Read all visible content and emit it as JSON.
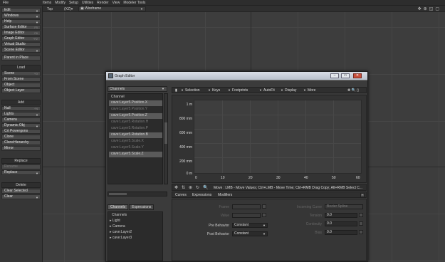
{
  "topbar": {
    "file_label": "File",
    "menu": [
      "Items",
      "Modify",
      "Setup",
      "Utilities",
      "Render",
      "View",
      "Modeler Tools"
    ]
  },
  "sidebar": {
    "buttons": [
      {
        "label": "Edit",
        "arrow": true
      },
      {
        "label": "Windows",
        "arrow": true
      },
      {
        "label": "Help",
        "arrow": true
      },
      {
        "label": "Surface Editor",
        "key": "F5"
      },
      {
        "label": "Image Editor",
        "key": "F6"
      },
      {
        "label": "Graph Editor",
        "key": "^F2"
      },
      {
        "label": "Virtual Studio"
      },
      {
        "label": "Scene Editor",
        "arrow": true
      },
      {
        "label": "Parent in Place"
      }
    ],
    "load_head": "Load",
    "load_buttons": [
      {
        "label": "Scene",
        "key": "^O"
      },
      {
        "label": "From Scene"
      },
      {
        "label": "Object"
      },
      {
        "label": "Object Layer"
      }
    ],
    "add_head": "Add",
    "add_buttons": [
      {
        "label": "Null",
        "key": "^N"
      },
      {
        "label": "Lights",
        "arrow": true
      },
      {
        "label": "Camera"
      },
      {
        "label": "Dynamic Obj",
        "arrow": true
      },
      {
        "label": "Crt Powergons"
      },
      {
        "label": "Clone"
      },
      {
        "label": "CloneHierarchy"
      },
      {
        "label": "Mirror"
      }
    ],
    "replace_head": "Replace",
    "replace_buttons": [
      {
        "label": "Rename",
        "dim": true
      },
      {
        "label": "Replace",
        "arrow": true
      }
    ],
    "delete_head": "Delete",
    "delete_buttons": [
      {
        "label": "Clear Selected"
      },
      {
        "label": "Clear",
        "arrow": true
      }
    ]
  },
  "viewport": {
    "view": "Top",
    "mode": "(XZ)▾",
    "shading": "▣ Wireframe",
    "icons": [
      "✥",
      "⊕",
      "◱",
      "▢"
    ]
  },
  "graph_editor": {
    "title": "Graph Editor",
    "win_buttons": [
      "–",
      "▭",
      "✕"
    ],
    "channels_dropdown": "Channels",
    "channel_header": "Channel",
    "channels": [
      {
        "label": "cave:Layer5.Position.X",
        "state": "sel"
      },
      {
        "label": "cave:Layer5.Position.Y",
        "state": "dim"
      },
      {
        "label": "cave:Layer5.Position.Z",
        "state": "sel"
      },
      {
        "label": "cave:Layer5.Rotation.H",
        "state": "dim"
      },
      {
        "label": "cave:Layer5.Rotation.P",
        "state": "dim"
      },
      {
        "label": "cave:Layer5.Rotation.B",
        "state": "sel"
      },
      {
        "label": "cave:Layer5.Scale.X",
        "state": "dim"
      },
      {
        "label": "cave:Layer5.Scale.Y",
        "state": "dim"
      },
      {
        "label": "cave:Layer5.Scale.Z",
        "state": "sel"
      }
    ],
    "left_tabs": [
      "Channels",
      "Expressions"
    ],
    "tree_header": "Channels",
    "tree": [
      "▸ Light",
      "▸ Camera",
      "▸ cave:Layer2",
      "▸ cave:Layer3"
    ],
    "toolbar": {
      "selection": "Selection",
      "keys": "Keys",
      "footprints": "Footprints",
      "autofit": "AutoFit",
      "display": "Display",
      "more": "More",
      "zoom_icons": "✥ 🔍 ▯"
    },
    "graph": {
      "y_labels": [
        "1 m",
        "800 mm",
        "600 mm",
        "400 mm",
        "200 mm",
        "0 m"
      ],
      "x_labels": [
        "0",
        "10",
        "20",
        "30",
        "40",
        "50",
        "60"
      ]
    },
    "status_icons": [
      "✥",
      "⇅",
      "⊕",
      "↻",
      "🔍"
    ],
    "status_text": "Move : LMB - Move Values; Ctrl+LMB - Move Time; Ctrl+RMB Drag Copy; Alt+RMB Select C...",
    "bottom_tabs": [
      "Curves",
      "Expressions",
      "Modifiers"
    ],
    "curves": {
      "frame_label": "Frame",
      "value_label": "Value",
      "pre_behavior_label": "Pre Behavior",
      "pre_behavior_value": "Constant",
      "post_behavior_label": "Post Behavior",
      "post_behavior_value": "Constant",
      "incoming_curve_label": "Incoming Curve",
      "incoming_curve_value": "Bezier Spline",
      "tension_label": "Tension",
      "tension_value": "0.0",
      "continuity_label": "Continuity",
      "continuity_value": "0.0",
      "bias_label": "Bias",
      "bias_value": "0.0"
    }
  }
}
